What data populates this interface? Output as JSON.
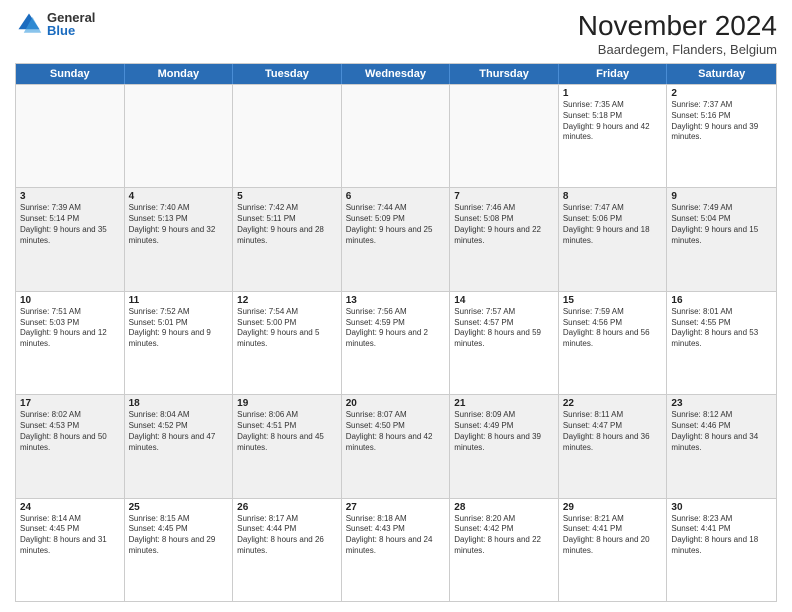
{
  "logo": {
    "general": "General",
    "blue": "Blue"
  },
  "title": "November 2024",
  "location": "Baardegem, Flanders, Belgium",
  "days": [
    "Sunday",
    "Monday",
    "Tuesday",
    "Wednesday",
    "Thursday",
    "Friday",
    "Saturday"
  ],
  "weeks": [
    [
      {
        "day": "",
        "info": "",
        "empty": true
      },
      {
        "day": "",
        "info": "",
        "empty": true
      },
      {
        "day": "",
        "info": "",
        "empty": true
      },
      {
        "day": "",
        "info": "",
        "empty": true
      },
      {
        "day": "",
        "info": "",
        "empty": true
      },
      {
        "day": "1",
        "info": "Sunrise: 7:35 AM\nSunset: 5:18 PM\nDaylight: 9 hours and 42 minutes."
      },
      {
        "day": "2",
        "info": "Sunrise: 7:37 AM\nSunset: 5:16 PM\nDaylight: 9 hours and 39 minutes."
      }
    ],
    [
      {
        "day": "3",
        "info": "Sunrise: 7:39 AM\nSunset: 5:14 PM\nDaylight: 9 hours and 35 minutes."
      },
      {
        "day": "4",
        "info": "Sunrise: 7:40 AM\nSunset: 5:13 PM\nDaylight: 9 hours and 32 minutes."
      },
      {
        "day": "5",
        "info": "Sunrise: 7:42 AM\nSunset: 5:11 PM\nDaylight: 9 hours and 28 minutes."
      },
      {
        "day": "6",
        "info": "Sunrise: 7:44 AM\nSunset: 5:09 PM\nDaylight: 9 hours and 25 minutes."
      },
      {
        "day": "7",
        "info": "Sunrise: 7:46 AM\nSunset: 5:08 PM\nDaylight: 9 hours and 22 minutes."
      },
      {
        "day": "8",
        "info": "Sunrise: 7:47 AM\nSunset: 5:06 PM\nDaylight: 9 hours and 18 minutes."
      },
      {
        "day": "9",
        "info": "Sunrise: 7:49 AM\nSunset: 5:04 PM\nDaylight: 9 hours and 15 minutes."
      }
    ],
    [
      {
        "day": "10",
        "info": "Sunrise: 7:51 AM\nSunset: 5:03 PM\nDaylight: 9 hours and 12 minutes."
      },
      {
        "day": "11",
        "info": "Sunrise: 7:52 AM\nSunset: 5:01 PM\nDaylight: 9 hours and 9 minutes."
      },
      {
        "day": "12",
        "info": "Sunrise: 7:54 AM\nSunset: 5:00 PM\nDaylight: 9 hours and 5 minutes."
      },
      {
        "day": "13",
        "info": "Sunrise: 7:56 AM\nSunset: 4:59 PM\nDaylight: 9 hours and 2 minutes."
      },
      {
        "day": "14",
        "info": "Sunrise: 7:57 AM\nSunset: 4:57 PM\nDaylight: 8 hours and 59 minutes."
      },
      {
        "day": "15",
        "info": "Sunrise: 7:59 AM\nSunset: 4:56 PM\nDaylight: 8 hours and 56 minutes."
      },
      {
        "day": "16",
        "info": "Sunrise: 8:01 AM\nSunset: 4:55 PM\nDaylight: 8 hours and 53 minutes."
      }
    ],
    [
      {
        "day": "17",
        "info": "Sunrise: 8:02 AM\nSunset: 4:53 PM\nDaylight: 8 hours and 50 minutes."
      },
      {
        "day": "18",
        "info": "Sunrise: 8:04 AM\nSunset: 4:52 PM\nDaylight: 8 hours and 47 minutes."
      },
      {
        "day": "19",
        "info": "Sunrise: 8:06 AM\nSunset: 4:51 PM\nDaylight: 8 hours and 45 minutes."
      },
      {
        "day": "20",
        "info": "Sunrise: 8:07 AM\nSunset: 4:50 PM\nDaylight: 8 hours and 42 minutes."
      },
      {
        "day": "21",
        "info": "Sunrise: 8:09 AM\nSunset: 4:49 PM\nDaylight: 8 hours and 39 minutes."
      },
      {
        "day": "22",
        "info": "Sunrise: 8:11 AM\nSunset: 4:47 PM\nDaylight: 8 hours and 36 minutes."
      },
      {
        "day": "23",
        "info": "Sunrise: 8:12 AM\nSunset: 4:46 PM\nDaylight: 8 hours and 34 minutes."
      }
    ],
    [
      {
        "day": "24",
        "info": "Sunrise: 8:14 AM\nSunset: 4:45 PM\nDaylight: 8 hours and 31 minutes."
      },
      {
        "day": "25",
        "info": "Sunrise: 8:15 AM\nSunset: 4:45 PM\nDaylight: 8 hours and 29 minutes."
      },
      {
        "day": "26",
        "info": "Sunrise: 8:17 AM\nSunset: 4:44 PM\nDaylight: 8 hours and 26 minutes."
      },
      {
        "day": "27",
        "info": "Sunrise: 8:18 AM\nSunset: 4:43 PM\nDaylight: 8 hours and 24 minutes."
      },
      {
        "day": "28",
        "info": "Sunrise: 8:20 AM\nSunset: 4:42 PM\nDaylight: 8 hours and 22 minutes."
      },
      {
        "day": "29",
        "info": "Sunrise: 8:21 AM\nSunset: 4:41 PM\nDaylight: 8 hours and 20 minutes."
      },
      {
        "day": "30",
        "info": "Sunrise: 8:23 AM\nSunset: 4:41 PM\nDaylight: 8 hours and 18 minutes."
      }
    ]
  ]
}
